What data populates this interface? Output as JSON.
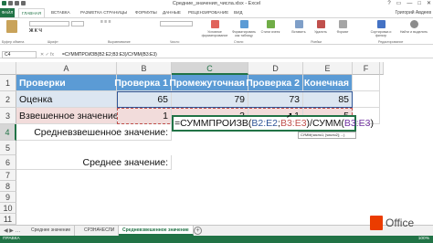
{
  "window": {
    "title": "Средние_значения_числа.xlsx - Excel",
    "user": "Григорий Авдеев",
    "controls": [
      "?",
      "▭",
      "—",
      "□",
      "✕"
    ]
  },
  "ribbon_tabs": [
    "ФАЙЛ",
    "ГЛАВНАЯ",
    "ВСТАВКА",
    "РАЗМЕТКА СТРАНИЦЫ",
    "ФОРМУЛЫ",
    "ДАННЫЕ",
    "РЕЦЕНЗИРОВАНИЕ",
    "ВИД"
  ],
  "ribbon_active_tab": "ГЛАВНАЯ",
  "ribbon_group_labels": [
    "Буфер обмена",
    "Шрифт",
    "Выравнивание",
    "Число",
    "Стили",
    "Ячейки",
    "Редактирование"
  ],
  "ribbon_commands": [
    "Условное форматирование",
    "Форматировать как таблицу",
    "Стили ячеек",
    "Вставить",
    "Удалить",
    "Формат",
    "Сортировка и фильтр",
    "Найти и выделить"
  ],
  "formula_bar": {
    "name_box": "C4",
    "icons": "✕ ✓ fx",
    "formula": "=СУММПРОИЗВ(B2:E2;B3:E3)/СУММ(B3:E3)"
  },
  "columns": [
    "A",
    "B",
    "C",
    "D",
    "E",
    "F",
    "G"
  ],
  "rows": [
    "1",
    "2",
    "3",
    "4",
    "5",
    "6",
    "7",
    "8",
    "9",
    "10",
    "11"
  ],
  "sheet": {
    "r1": {
      "a": "Проверки",
      "b": "Проверка 1",
      "c": "Промежуточная",
      "d": "Проверка 2",
      "e": "Конечная"
    },
    "r2": {
      "a": "Оценка",
      "b": "65",
      "c": "79",
      "d": "73",
      "e": "85"
    },
    "r3": {
      "a": "Взвешенное значение",
      "b": "1",
      "c": "3",
      "d": "1",
      "e": "5"
    },
    "r4_label": "Средневзвешенное значение:",
    "r6_label": "Среднее значение:"
  },
  "editing_cell": {
    "func": "=СУММПРОИЗВ(",
    "r1": "B2:E2",
    "sep": ";",
    "r2": "B3:E3",
    "mid": ")/СУММ(",
    "r3": "B3:E3",
    "end": ")"
  },
  "tooltip": "СУММ(число1; [число2]; ...)",
  "sheet_tabs": [
    "Среднее значение",
    "СРЗНАЧЕСЛИ",
    "Средневзвешенное значение"
  ],
  "active_sheet": "Средневзвешенное значение",
  "status": {
    "mode": "ПРАВКА",
    "zoom": "100%"
  },
  "brand": {
    "office_word": "Office"
  },
  "colors": {
    "accent": "#217346",
    "header_fill": "#5b9bd5",
    "blue_fill": "#dce6f1",
    "pink_fill": "#f2dcdb",
    "range1": "#2f5597",
    "range2": "#c0504d",
    "range3": "#7030a0"
  }
}
